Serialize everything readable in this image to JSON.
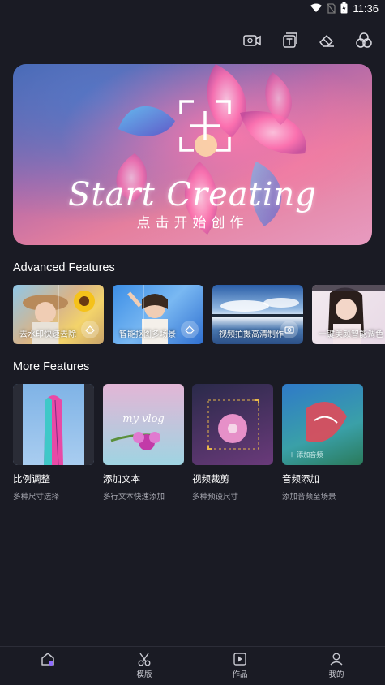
{
  "status_bar": {
    "time": "11:36"
  },
  "toolbar": {
    "icons": [
      "video-camera-icon",
      "text-icon",
      "eraser-icon",
      "color-circles-icon"
    ]
  },
  "banner": {
    "title": "Start Creating",
    "subtitle": "点击开始创作"
  },
  "advanced": {
    "heading": "Advanced Features",
    "cards": [
      {
        "label": "去水印快速去除"
      },
      {
        "label": "智能抠图多场景"
      },
      {
        "label": "视频拍摄高清制作"
      },
      {
        "label": "一键美颜智能调色"
      }
    ]
  },
  "more": {
    "heading": "More Features",
    "items": [
      {
        "name": "比例调整",
        "desc": "多种尺寸选择"
      },
      {
        "name": "添加文本",
        "desc": "多行文本快速添加"
      },
      {
        "name": "视频裁剪",
        "desc": "多种预设尺寸"
      },
      {
        "name": "音频添加",
        "desc": "添加音频至场景"
      }
    ],
    "text_overlay": "my vlog",
    "audio_overlay": "添加音频"
  },
  "bottom_nav": {
    "items": [
      {
        "label": ""
      },
      {
        "label": "模版"
      },
      {
        "label": "作品"
      },
      {
        "label": "我的"
      }
    ]
  },
  "colors": {
    "background": "#1a1b24",
    "accent": "#8f6cff"
  }
}
